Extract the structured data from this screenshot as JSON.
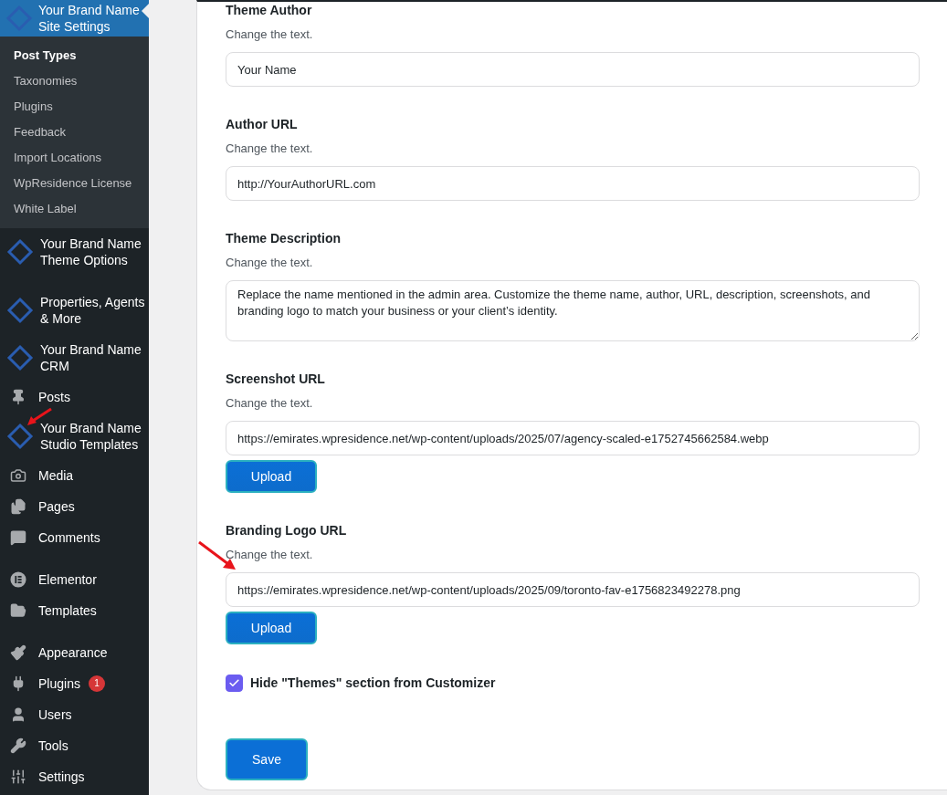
{
  "sidebar": {
    "active_item": {
      "label": "Your Brand Name Site Settings",
      "selected": true
    },
    "submenu": [
      {
        "label": "Post Types",
        "selected": true
      },
      {
        "label": "Taxonomies",
        "selected": false
      },
      {
        "label": "Plugins",
        "selected": false
      },
      {
        "label": "Feedback",
        "selected": false
      },
      {
        "label": "Import Locations",
        "selected": false
      },
      {
        "label": "WpResidence License",
        "selected": false
      },
      {
        "label": "White Label",
        "selected": false
      }
    ],
    "groups": [
      {
        "items": [
          {
            "kind": "brand",
            "label": "Your Brand Name Theme Options"
          }
        ]
      },
      {
        "items": [
          {
            "kind": "brand",
            "label": "Properties, Agents & More"
          },
          {
            "kind": "brand",
            "label": "Your Brand Name CRM"
          },
          {
            "kind": "pin",
            "label": "Posts"
          },
          {
            "kind": "brand",
            "label": "Your Brand Name Studio Templates"
          },
          {
            "kind": "media",
            "label": "Media"
          },
          {
            "kind": "pages",
            "label": "Pages"
          },
          {
            "kind": "comments",
            "label": "Comments"
          }
        ]
      },
      {
        "items": [
          {
            "kind": "elementor",
            "label": "Elementor"
          },
          {
            "kind": "folder",
            "label": "Templates"
          }
        ]
      },
      {
        "items": [
          {
            "kind": "brush",
            "label": "Appearance"
          },
          {
            "kind": "plug",
            "label": "Plugins",
            "badge": "1"
          },
          {
            "kind": "user",
            "label": "Users"
          },
          {
            "kind": "wrench",
            "label": "Tools"
          },
          {
            "kind": "sliders",
            "label": "Settings"
          }
        ]
      }
    ]
  },
  "form": {
    "fields": [
      {
        "kind": "input",
        "label": "Theme Author",
        "help": "Change the text.",
        "value": "Your Name"
      },
      {
        "kind": "input",
        "label": "Author URL",
        "help": "Change the text.",
        "value": "http://YourAuthorURL.com"
      },
      {
        "kind": "textarea",
        "label": "Theme Description",
        "help": "Change the text.",
        "value": "Replace the name mentioned in the admin area. Customize the theme name, author, URL, description, screenshots, and branding logo to match your business or your client’s identity."
      },
      {
        "kind": "input",
        "label": "Screenshot URL",
        "help": "Change the text.",
        "value": "https://emirates.wpresidence.net/wp-content/uploads/2025/07/agency-scaled-e1752745662584.webp",
        "button": "Upload"
      },
      {
        "kind": "input",
        "label": "Branding Logo URL",
        "help": "Change the text.",
        "value": "https://emirates.wpresidence.net/wp-content/uploads/2025/09/toronto-fav-e1756823492278.png",
        "button": "Upload"
      }
    ],
    "checkbox": {
      "label": "Hide \"Themes\" section from Customizer",
      "checked": true
    },
    "save_button": "Save"
  }
}
